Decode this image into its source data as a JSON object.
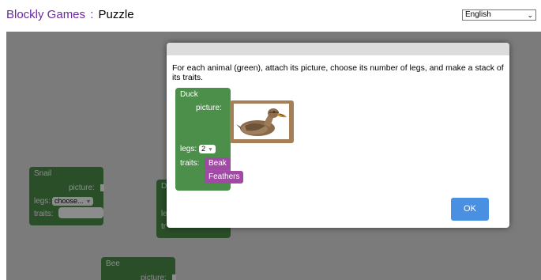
{
  "header": {
    "brand": "Blockly Games",
    "separator": ":",
    "title": "Puzzle",
    "language": "English"
  },
  "workspace": {
    "snail": {
      "name": "Snail",
      "picture_label": "picture:",
      "legs_label": "legs:",
      "legs_value": "choose...",
      "traits_label": "traits:"
    },
    "partial_block": {
      "name": "D",
      "legs_label": "le",
      "traits_label": "tr"
    },
    "bee": {
      "name": "Bee",
      "picture_label": "picture:"
    }
  },
  "dialog": {
    "instructions": "For each animal (green), attach its picture, choose its number of legs, and make a stack of its traits.",
    "duck": {
      "name": "Duck",
      "picture_label": "picture:",
      "legs_label": "legs:",
      "legs_value": "2",
      "traits_label": "traits:",
      "traits": [
        "Beak",
        "Feathers"
      ]
    },
    "ok_label": "OK"
  },
  "colors": {
    "animal_block": "#4c8f4a",
    "trait_block": "#a049a5",
    "picture_frame": "#a47f58",
    "ok_button": "#4a90e2",
    "brand": "#6a2a9e"
  }
}
